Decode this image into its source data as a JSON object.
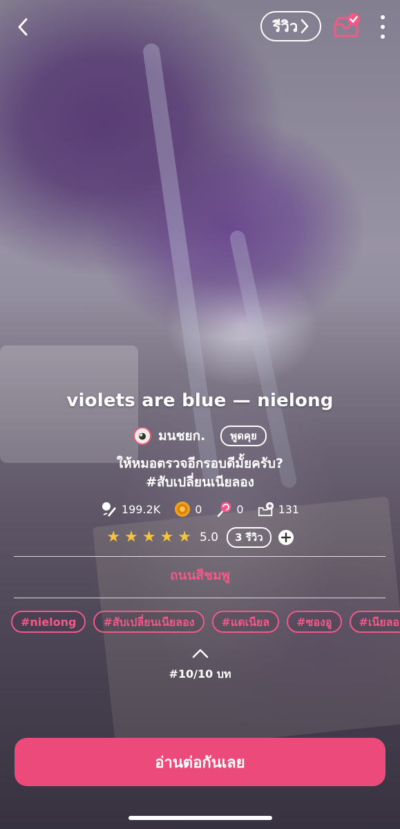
{
  "header": {
    "review_label": "รีวิว",
    "icons": {
      "back": "chevron-left-icon",
      "library": "add-to-shelf-icon",
      "more": "more-vertical-icon"
    },
    "accent_color": "#f15a87"
  },
  "novel": {
    "title": "violets are blue — nielong",
    "author": "มนชยก.",
    "chat_label": "พูดคุย",
    "synopsis_line1": "ให้หมอตรวจอีกรอบดีมั้ยครับ?",
    "synopsis_line2": "#สับเปลี่ยนเนียลอง",
    "stats": {
      "views": "199.2K",
      "coins": "0",
      "lollipops": "0",
      "shelf_adds": "131"
    },
    "rating": {
      "stars": 5,
      "value": "5.0",
      "review_count_label": "3 รีวิว"
    },
    "genre": "ถนนสีชมพู",
    "tags": [
      "#nielong",
      "#สับเปลี่ยนเนียลอง",
      "#แดเนียล",
      "#ซองอู",
      "#เนียลอง"
    ],
    "chapter_label": "#10/10 บท"
  },
  "cta": {
    "read_label": "อ่านต่อกันเลย",
    "color": "#eb4a7a"
  }
}
